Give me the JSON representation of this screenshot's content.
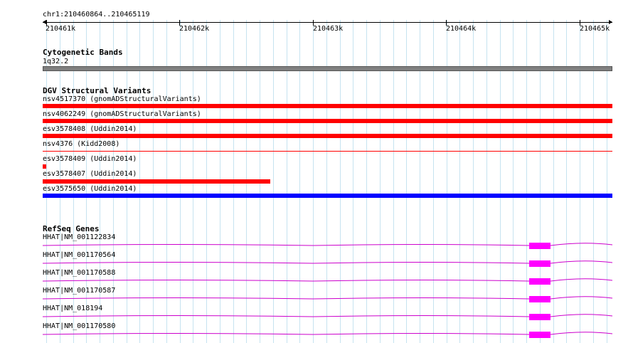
{
  "locus": "chr1:210460864..210465119",
  "ruler": {
    "ticks": [
      "210461k",
      "210462k",
      "210463k",
      "210464k",
      "210465k"
    ]
  },
  "tracks": {
    "cytoband": {
      "title": "Cytogenetic Bands",
      "band": "1q32.2",
      "color": "#808080"
    },
    "dgv": {
      "title": "DGV Structural Variants",
      "items": [
        {
          "label": "nsv4517370 (gnomADStructuralVariants)",
          "color": "#ff0000"
        },
        {
          "label": "nsv4062249 (gnomADStructuralVariants)",
          "color": "#ff0000"
        },
        {
          "label": "esv3578408 (Uddin2014)",
          "color": "#ff0000"
        },
        {
          "label": "nsv4376 (Kidd2008)",
          "color": "#ff0000"
        },
        {
          "label": "esv3578409 (Uddin2014)",
          "color": "#ff0000"
        },
        {
          "label": "esv3578407 (Uddin2014)",
          "color": "#ff0000"
        },
        {
          "label": "esv3575650 (Uddin2014)",
          "color": "#0000ff"
        }
      ]
    },
    "refseq": {
      "title": "RefSeq Genes",
      "color": "#ff00ff",
      "items": [
        {
          "label": "HHAT|NM_001122834"
        },
        {
          "label": "HHAT|NM_001170564"
        },
        {
          "label": "HHAT|NM_001170588"
        },
        {
          "label": "HHAT|NM_001170587"
        },
        {
          "label": "HHAT|NM_018194"
        },
        {
          "label": "HHAT|NM_001170580"
        }
      ]
    }
  }
}
